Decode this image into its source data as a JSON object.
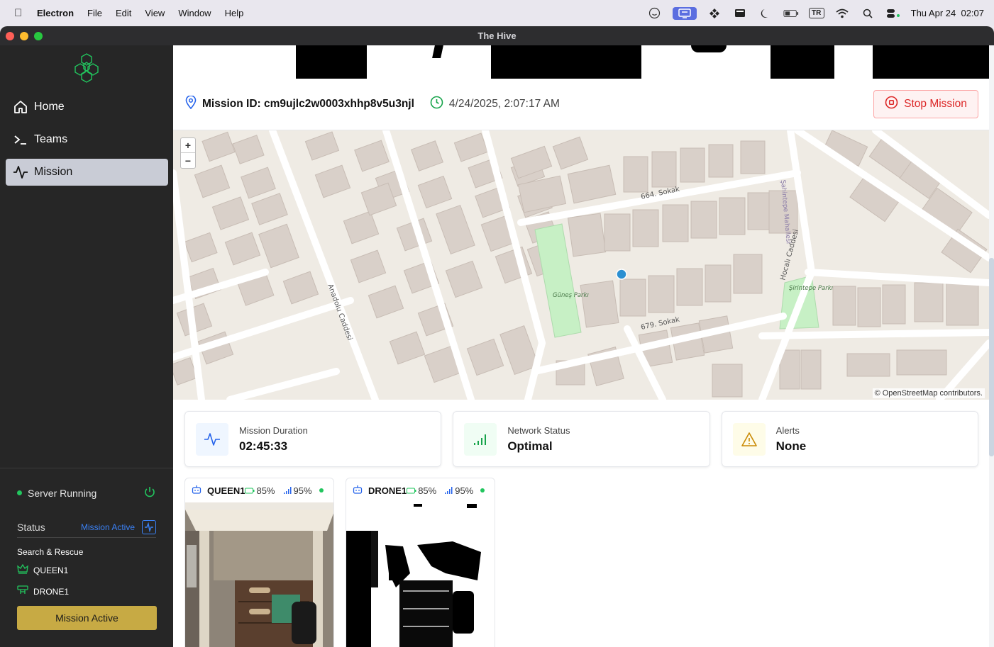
{
  "menubar": {
    "app": "Electron",
    "items": [
      "File",
      "Edit",
      "View",
      "Window",
      "Help"
    ],
    "input_source": "TR",
    "datetime": "Thu Apr 24  02:07"
  },
  "window": {
    "title": "The Hive"
  },
  "sidebar": {
    "nav": [
      {
        "label": "Home",
        "icon": "home-icon"
      },
      {
        "label": "Teams",
        "icon": "terminal-icon"
      },
      {
        "label": "Mission",
        "icon": "activity-icon",
        "active": true
      }
    ],
    "server_status": "Server Running",
    "status_label": "Status",
    "status_value": "Mission Active",
    "mission_name": "Search & Rescue",
    "units": [
      {
        "name": "QUEEN1",
        "icon": "crown-icon"
      },
      {
        "name": "DRONE1",
        "icon": "drone-icon"
      }
    ],
    "mission_button": "Mission Active"
  },
  "mission": {
    "id_text": "Mission ID: cm9ujlc2w0003xhhp8v5u3njl",
    "timestamp": "4/24/2025, 2:07:17 AM",
    "stop_label": "Stop Mission"
  },
  "map": {
    "zoom_in": "+",
    "zoom_out": "−",
    "attribution": "© OpenStreetMap contributors.",
    "labels": {
      "street1": "664. Sokak",
      "street2": "679. Sokak",
      "avenue1": "Anadolu Caddesi",
      "avenue2": "Hocalı Caddesi",
      "district": "Şahintepe Mahallesi",
      "park1": "Güneş Parkı",
      "park2": "Şirintepe Parkı"
    }
  },
  "stats": [
    {
      "label": "Mission Duration",
      "value": "02:45:33",
      "icon": "activity-icon",
      "color": "#2563eb"
    },
    {
      "label": "Network Status",
      "value": "Optimal",
      "icon": "signal-icon",
      "color": "#16a34a"
    },
    {
      "label": "Alerts",
      "value": "None",
      "icon": "warning-icon",
      "color": "#ca8a04"
    }
  ],
  "feeds": [
    {
      "name": "QUEEN1",
      "battery": "85%",
      "signal": "95%"
    },
    {
      "name": "DRONE1",
      "battery": "85%",
      "signal": "95%"
    }
  ]
}
